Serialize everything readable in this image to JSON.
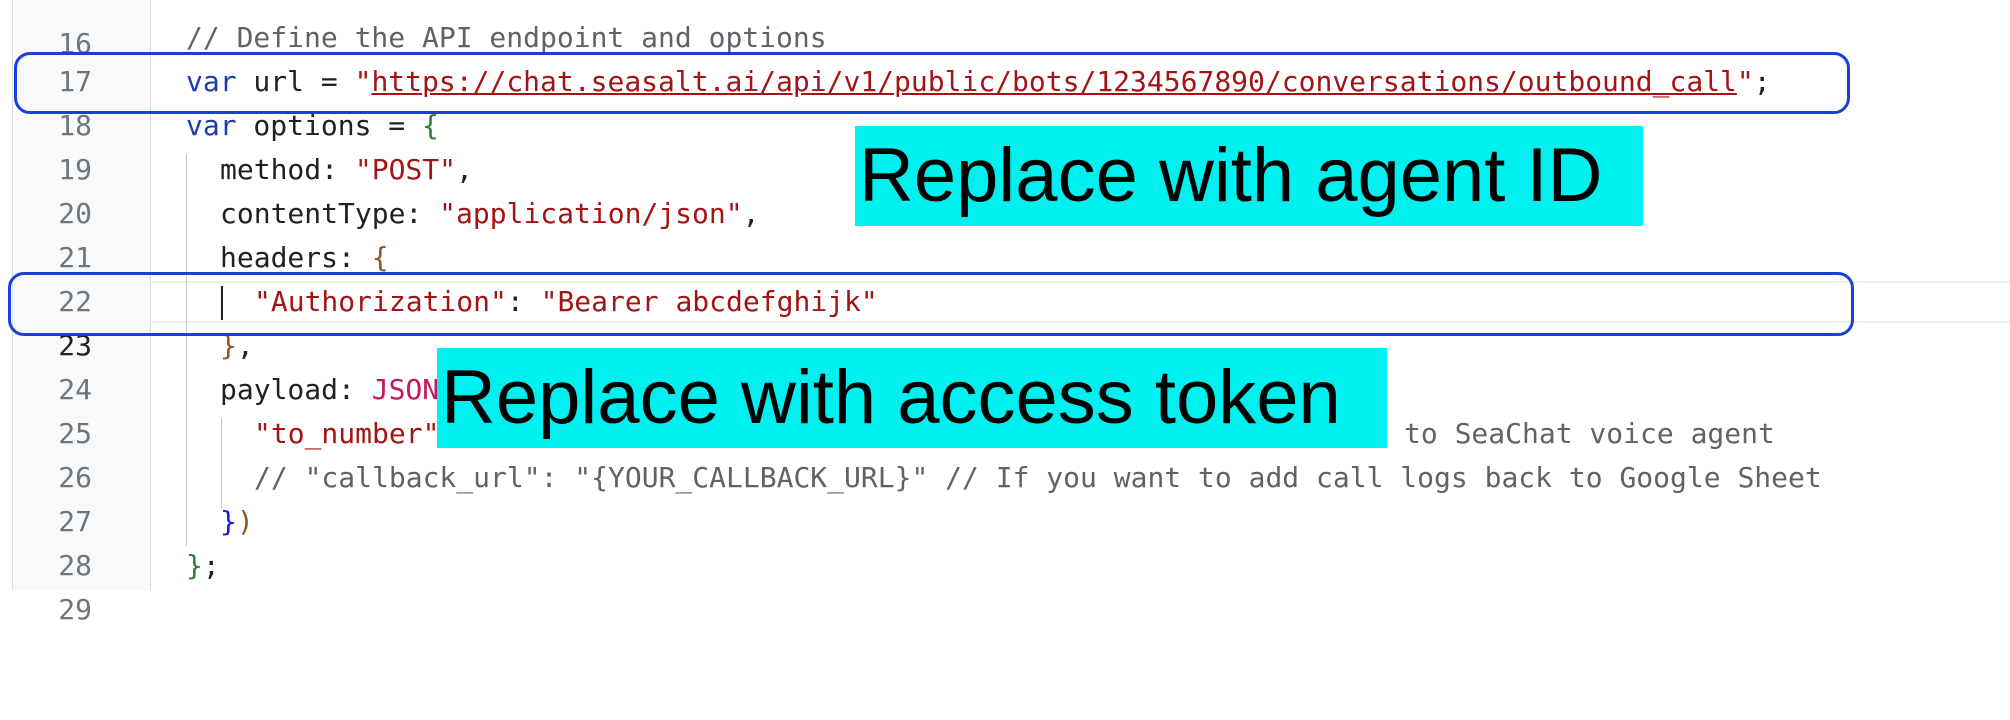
{
  "line_numbers": [
    "16",
    "17",
    "18",
    "19",
    "20",
    "21",
    "22",
    "23",
    "24",
    "25",
    "26",
    "27",
    "28",
    "29"
  ],
  "code": {
    "l17": {
      "comment": "// Define the API endpoint and options"
    },
    "l18": {
      "kw": "var",
      "ident": " url = ",
      "q1": "\"",
      "url": "https://chat.seasalt.ai/api/v1/public/bots/1234567890/conversations/outbound_call",
      "q2": "\"",
      "end": ";"
    },
    "l19": {
      "kw": "var",
      "ident": " options = ",
      "brace": "{"
    },
    "l20": {
      "key": "method: ",
      "val": "\"POST\"",
      "end": ","
    },
    "l21": {
      "key": "contentType: ",
      "val": "\"application/json\"",
      "end": ","
    },
    "l22": {
      "key": "headers: ",
      "brace": "{"
    },
    "l23": {
      "key": "\"Authorization\"",
      "sep": ": ",
      "val": "\"Bearer abcdefghijk\""
    },
    "l24": {
      "brace": "}",
      "end": ","
    },
    "l25": {
      "key": "payload: ",
      "fn": "JSON"
    },
    "l26": {
      "key": "\"to_number\"",
      "comment": "to SeaChat voice agent"
    },
    "l27": {
      "comment": "// \"callback_url\": \"{YOUR_CALLBACK_URL}\" // If you want to add call logs back to Google Sheet"
    },
    "l28": {
      "brace1": "}",
      "brace2": ")"
    },
    "l29": {
      "brace": "}",
      "end": ";"
    }
  },
  "annotations": {
    "agent_id_callout": "Replace with agent ID",
    "access_token_callout": "Replace with access token",
    "callout_color": "#00f0f0",
    "box_color": "#1a3fd6"
  },
  "colors": {
    "keyword": "#1a3fa6",
    "string": "#a31515",
    "comment": "#5f6368"
  }
}
